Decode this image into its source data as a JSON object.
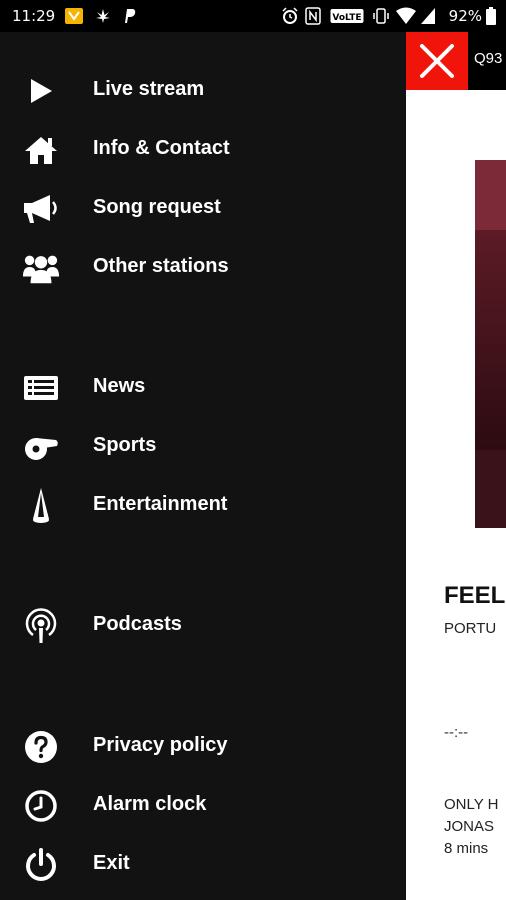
{
  "status_bar": {
    "time": "11:29",
    "battery": "92%",
    "network": "VoLTE"
  },
  "app": {
    "station_name": "Q93",
    "now_playing": {
      "title": "FEEL",
      "artist": "PORTU",
      "time": "--:--"
    },
    "news": {
      "line1": "ONLY H",
      "line2": "JONAS",
      "line3": "8 mins"
    }
  },
  "menu": {
    "items": [
      {
        "label": "Live stream",
        "icon": "play-icon"
      },
      {
        "label": "Info & Contact",
        "icon": "home-icon"
      },
      {
        "label": "Song request",
        "icon": "megaphone-icon"
      },
      {
        "label": "Other stations",
        "icon": "group-icon"
      },
      {
        "label": "News",
        "icon": "newspaper-icon"
      },
      {
        "label": "Sports",
        "icon": "whistle-icon"
      },
      {
        "label": "Entertainment",
        "icon": "spotlight-icon"
      },
      {
        "label": "Podcasts",
        "icon": "podcast-icon"
      },
      {
        "label": "Privacy policy",
        "icon": "question-icon"
      },
      {
        "label": "Alarm clock",
        "icon": "clock-icon"
      },
      {
        "label": "Exit",
        "icon": "power-icon"
      }
    ]
  },
  "colors": {
    "drawer_bg": "#121212",
    "close_button": "#f0140a",
    "menu_text": "#ffffff"
  }
}
